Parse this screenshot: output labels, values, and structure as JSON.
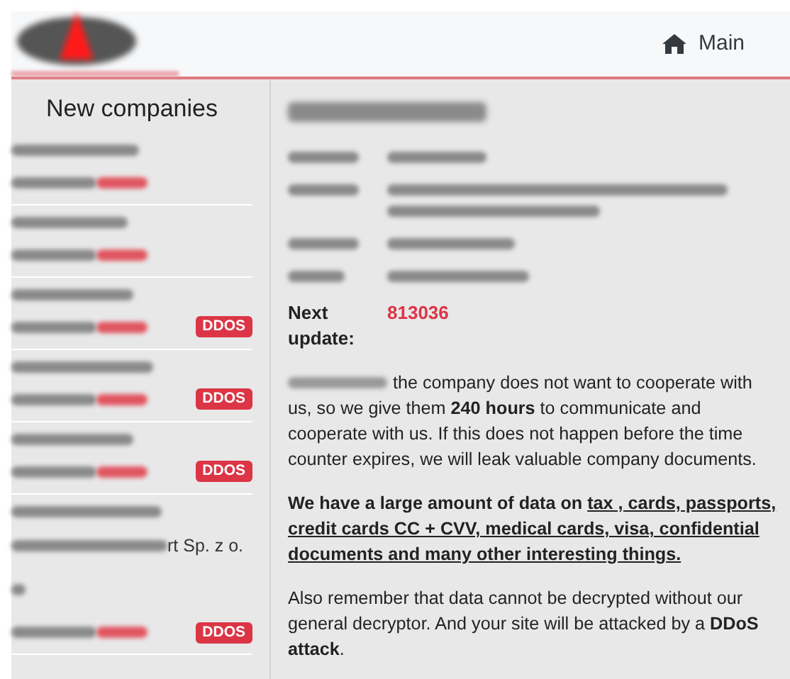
{
  "nav": {
    "link": "Main"
  },
  "sidebar": {
    "title": "New companies",
    "items": [
      {
        "kind": "plain"
      },
      {
        "kind": "plain"
      },
      {
        "kind": "ddos",
        "badge": "DDOS"
      },
      {
        "kind": "ddos",
        "badge": "DDOS"
      },
      {
        "kind": "ddos",
        "badge": "DDOS"
      },
      {
        "kind": "ddos",
        "badge": "DDOS",
        "visible_name_part": "rt Sp. z o."
      }
    ]
  },
  "detail": {
    "next_update_label": "Next update:",
    "next_update_value": "813036",
    "paragraphs": [
      {
        "kind": "intro",
        "text": "the company does not want to cooperate with us, so we give them **240 hours** to communicate and cooperate with us. If this does not happen before the time counter expires, we will leak valuable company documents."
      },
      {
        "kind": "data",
        "text": "We have a large amount of data on ",
        "underlined": "tax , cards, passports, credit cards CC + CVV, medical cards, visa, confidential documents and many other interesting things."
      },
      {
        "kind": "plain",
        "text": "Also remember that data cannot be decrypted without our general decryptor. And your site will be attacked by a **DDoS attack**."
      }
    ]
  }
}
